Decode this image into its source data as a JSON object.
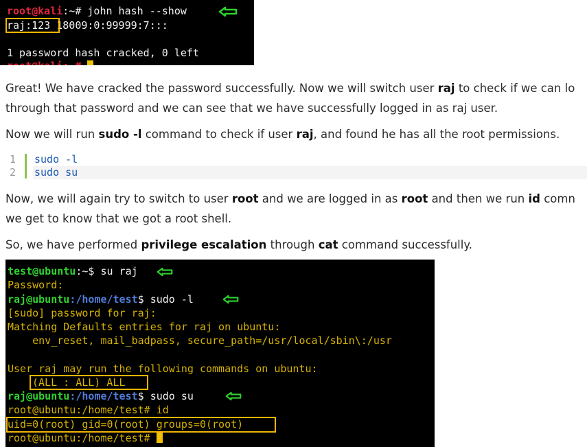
{
  "terminal1": {
    "line1_prompt_user": "root@kali",
    "line1_prompt_rest": ":~# ",
    "line1_cmd": "john hash --show",
    "line2_highlight": "raj:123",
    "line2_rest": " 18009:0:99999:7:::",
    "line4": "1 password hash cracked, 0 left",
    "line5_prompt": "root@kali:~# "
  },
  "para1_a": "Great! We have cracked the password successfully. Now we will switch user ",
  "para1_b": "raj",
  "para1_c": " to check if we can lo",
  "para1_line2": "through that password and we can see that we have successfully logged in as raj user.",
  "para2_a": "Now we will run ",
  "para2_b": "sudo -l",
  "para2_c": " command to check if user ",
  "para2_d": "raj",
  "para2_e": ", and found he has all the root permissions.",
  "code": {
    "lines": [
      "sudo -l",
      "sudo su"
    ],
    "line_numbers": [
      "1",
      "2"
    ]
  },
  "para3_a": "Now, we will again try to switch to user ",
  "para3_b": "root",
  "para3_c": " and we are logged in as ",
  "para3_d": "root",
  "para3_e": " and then we run ",
  "para3_f": "id",
  "para3_g": " comn",
  "para3_line2": "we get to know that we got a root shell.",
  "para4_a": "So, we have performed ",
  "para4_b": "privilege escalation",
  "para4_c": " through ",
  "para4_d": "cat",
  "para4_e": " command successfully.",
  "terminal2": {
    "l1_user": "test@ubuntu",
    "l1_sep": ":~$ ",
    "l1_cmd": "su raj",
    "l2": "Password:",
    "l3_user": "raj@ubuntu",
    "l3_path": ":/home/test",
    "l3_sep": "$ ",
    "l3_cmd": "sudo -l",
    "l4": "[sudo] password for raj:",
    "l5": "Matching Defaults entries for raj on ubuntu:",
    "l6": "    env_reset, mail_badpass, secure_path=/usr/local/sbin\\:/usr",
    "l8": "User raj may run the following commands on ubuntu:",
    "l9": "(ALL : ALL) ALL",
    "l10_user": "raj@ubuntu",
    "l10_path": ":/home/test",
    "l10_sep": "$ ",
    "l10_cmd": "sudo su",
    "l11": "root@ubuntu:/home/test# id",
    "l12": "uid=0(root) gid=0(root) groups=0(root)",
    "l13": "root@ubuntu:/home/test# "
  },
  "colors": {
    "prompt_red": "#e0263b",
    "prompt_green": "#2fd12f",
    "highlight_box": "#f2b600",
    "arrow": "#2fd12f"
  },
  "icons": {
    "arrow": "green-left-arrow-icon"
  }
}
